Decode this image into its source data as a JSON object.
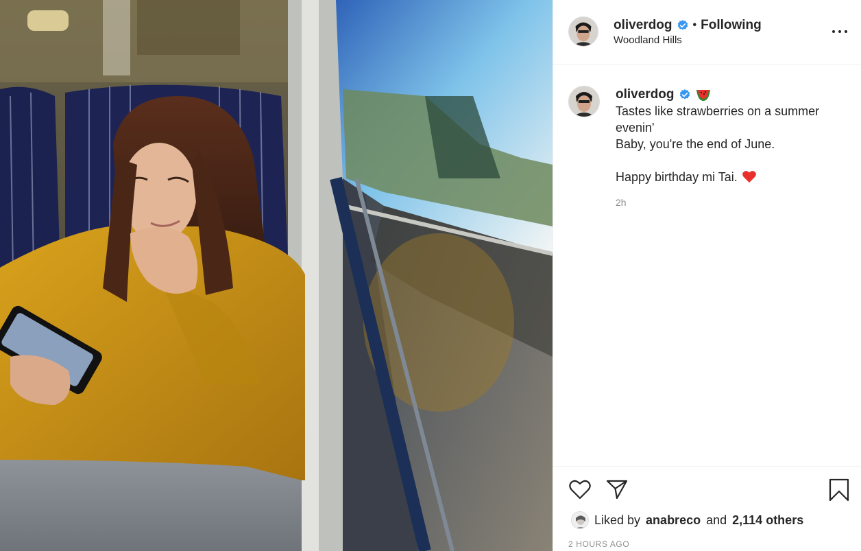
{
  "post": {
    "username": "oliverdog",
    "following_label": "Following",
    "location": "Woodland Hills",
    "caption_lines": "Tastes like strawberries on a summer evenin'\nBaby, you're the end of June.\n\nHappy birthday mi Tai.",
    "caption_emoji": "watermelon",
    "caption_heart": "red-heart",
    "time_ago": "2h",
    "liked_by_prefix": "Liked by",
    "liked_by_user": "anabreco",
    "liked_by_and": "and",
    "liked_by_others": "2,114 others",
    "post_age": "2 HOURS AGO"
  },
  "colors": {
    "verified_blue": "#3897f0",
    "text_primary": "#262626",
    "text_secondary": "#8e8e8e",
    "divider": "#efefef",
    "heart_red": "#e8302c"
  },
  "icons": {
    "more": "more-options-icon",
    "like": "heart-icon",
    "share": "paper-plane-icon",
    "save": "bookmark-icon",
    "verified": "verified-badge-icon"
  }
}
